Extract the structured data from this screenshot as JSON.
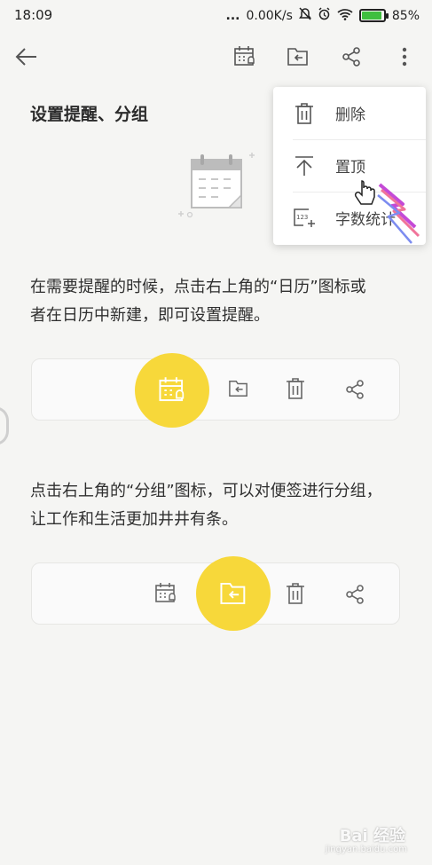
{
  "status_bar": {
    "time": "18:09",
    "dots": "...",
    "network_speed": "0.00K/s",
    "battery_percent": "85%",
    "battery_level": 0.85
  },
  "toolbar": {
    "icons": [
      "back-arrow-icon",
      "calendar-reminder-icon",
      "folder-group-icon",
      "share-icon",
      "more-vertical-icon"
    ]
  },
  "note": {
    "title": "设置提醒、分组",
    "paragraph1_line1": "在需要提醒的时候，点击右上角的“日历”图标或",
    "paragraph1_line2": "者在日历中新建，即可设置提醒。",
    "paragraph2_line1": "点击右上角的“分组”图标，可以对便签进行分组，",
    "paragraph2_line2": "让工作和生活更加井井有条。"
  },
  "menu": {
    "items": [
      {
        "label": "删除",
        "icon": "trash-icon"
      },
      {
        "label": "置顶",
        "icon": "pin-top-icon"
      },
      {
        "label": "字数统计",
        "icon": "word-count-icon"
      }
    ]
  },
  "colors": {
    "accent_yellow": "#f7d83a",
    "background": "#f5f5f3",
    "icon_gray": "#6b6b6b"
  },
  "watermark": {
    "text": "Bai 经验",
    "sub": "jingyan.baidu.com"
  }
}
